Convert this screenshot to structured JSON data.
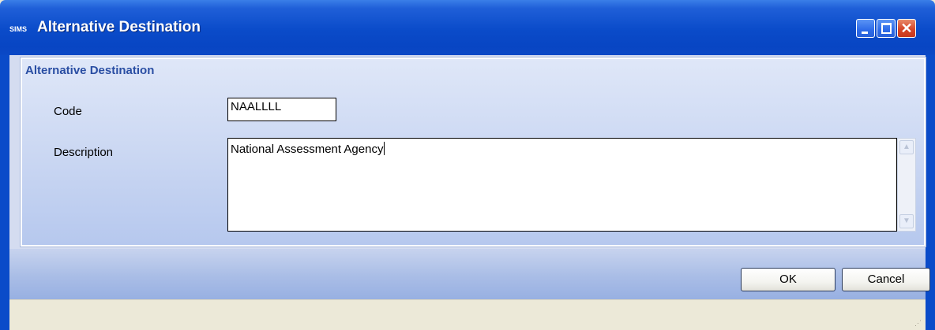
{
  "window": {
    "app_logo": "SIMS",
    "title": "Alternative Destination"
  },
  "group": {
    "title": "Alternative Destination"
  },
  "fields": {
    "code_label": "Code",
    "code_value": "NAALLLL",
    "description_label": "Description",
    "description_value": "National Assessment Agency"
  },
  "buttons": {
    "ok": "OK",
    "cancel": "Cancel"
  },
  "colors": {
    "titlebar": "#0a4bc9",
    "group_title": "#2a4ea3",
    "close_button": "#d6462a"
  }
}
